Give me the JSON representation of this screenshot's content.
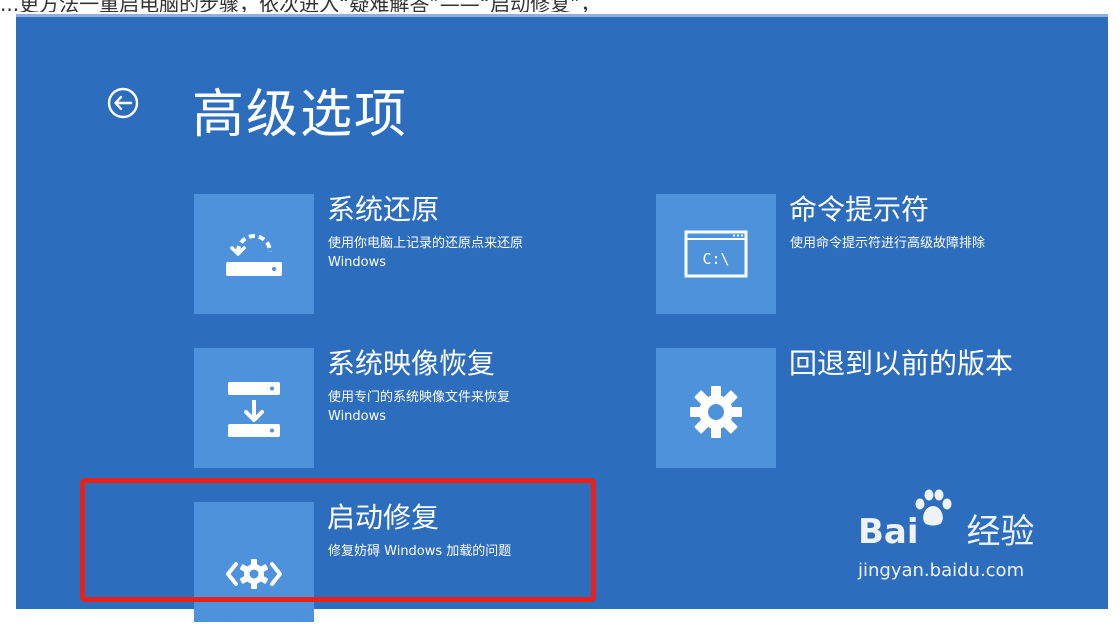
{
  "caption": "...更方法一重启电脑的步骤，依次进入“疑难解答”——“启动修复”，",
  "header": {
    "title": "高级选项",
    "back_icon": "back-arrow-icon"
  },
  "options": [
    {
      "title": "系统还原",
      "desc": [
        "使用你电脑上记录的还原点来还原",
        "Windows"
      ],
      "icon": "system-restore-icon"
    },
    {
      "title": "命令提示符",
      "desc": [
        "使用命令提示符进行高级故障排除"
      ],
      "icon": "command-prompt-icon",
      "icon_text": "C:\\"
    },
    {
      "title": "系统映像恢复",
      "desc": [
        "使用专门的系统映像文件来恢复",
        "Windows"
      ],
      "icon": "system-image-recovery-icon"
    },
    {
      "title": "回退到以前的版本",
      "desc": [],
      "icon": "gear-icon"
    },
    {
      "title": "启动修复",
      "desc": [
        "修复妨碍 Windows 加载的问题"
      ],
      "icon": "startup-repair-icon"
    }
  ],
  "watermark": {
    "logo_left": "Bai",
    "logo_right": "经验",
    "url": "jingyan.baidu.com"
  },
  "colors": {
    "background": "#2d6dbd",
    "tile": "#4f92dc",
    "highlight": "#e8221b"
  }
}
